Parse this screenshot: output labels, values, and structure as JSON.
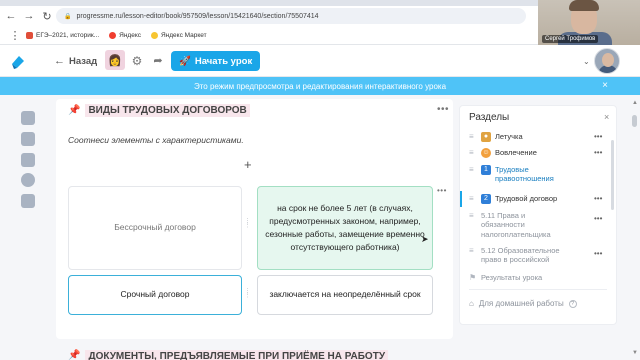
{
  "browser": {
    "url": "progressme.ru/lesson-editor/book/957509/lesson/15421640/section/75507414",
    "bookmarks": [
      {
        "label": "ЕГЭ–2021, историк...",
        "color": "#e04e39"
      },
      {
        "label": "Яндекс",
        "color": "#f03e2f"
      },
      {
        "label": "Яндекс Маркет",
        "color": "#f7c531"
      }
    ]
  },
  "webcam": {
    "name": "Сергей Трофимов"
  },
  "header": {
    "back_label": "Назад",
    "start_label": "Начать урок"
  },
  "banner": {
    "text": "Это режим предпросмотра и редактирования интерактивного урока"
  },
  "section": {
    "title": "ВИДЫ ТРУДОВЫХ ДОГОВОРОВ",
    "instruction": "Соотнеси элементы с характеристиками.",
    "left_items": [
      "Бессрочный договор",
      "Срочный договор"
    ],
    "right_items": [
      "на срок не более 5 лет (в случаях, предусмотренных законом, например, сезонные работы, замещение временно отсутствующего работника)",
      "заключается на неопределённый срок"
    ],
    "next_title": "ДОКУМЕНТЫ, ПРЕДЪЯВЛЯЕМЫЕ ПРИ ПРИЁМЕ НА РАБОТУ"
  },
  "panel": {
    "title": "Разделы",
    "items": [
      {
        "label": "Летучка"
      },
      {
        "label": "Вовлечение"
      },
      {
        "label": "Трудовые правоотношения",
        "num": "1"
      },
      {
        "label": "Трудовой договор",
        "num": "2"
      },
      {
        "label": "5.11 Права и обязанности налогоплательщика"
      },
      {
        "label": "5.12 Образовательное право в российской"
      },
      {
        "label": "Результаты урока"
      }
    ],
    "homework_label": "Для домашней работы",
    "homework_hint": "?"
  },
  "colors": {
    "accent": "#1aa6e8",
    "banner": "#4fc3f7",
    "match_bg": "#e6f7ef"
  }
}
